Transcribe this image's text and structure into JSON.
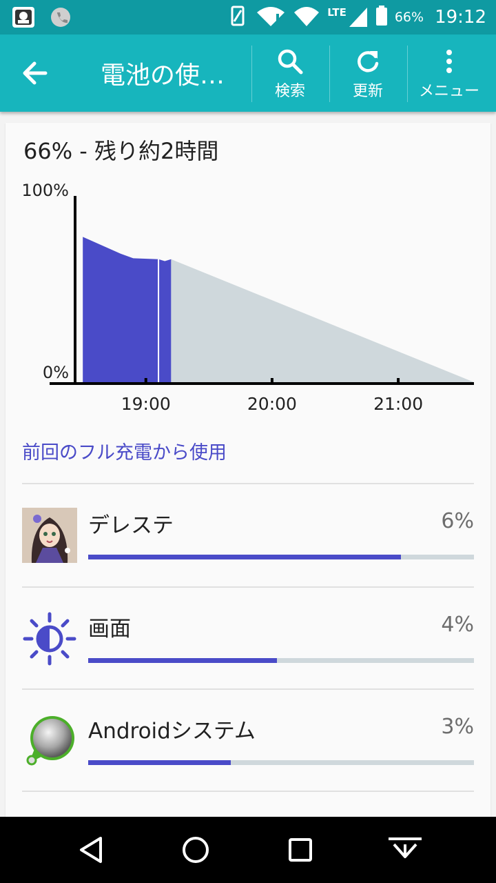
{
  "status_bar": {
    "battery": "66%",
    "time": "19:12",
    "network": "LTE"
  },
  "app_bar": {
    "back_icon": "arrow-left-icon",
    "title": "電池の使…",
    "actions": [
      {
        "icon": "search-icon",
        "label": "検索"
      },
      {
        "icon": "refresh-icon",
        "label": "更新"
      },
      {
        "icon": "more-vert-icon",
        "label": "メニュー"
      }
    ]
  },
  "summary": {
    "headline": "66% - 残り約2時間"
  },
  "chart_data": {
    "type": "area",
    "ylabels": [
      "100%",
      "0%"
    ],
    "ylim": [
      0,
      100
    ],
    "xticks": [
      "19:00",
      "20:00",
      "21:00"
    ],
    "series": [
      {
        "values": [
          [
            18.5,
            78
          ],
          [
            18.6,
            75
          ],
          [
            18.7,
            72
          ],
          [
            18.8,
            69
          ],
          [
            18.9,
            66.5
          ],
          [
            19.1,
            66
          ],
          [
            19.15,
            65
          ],
          [
            19.2,
            66
          ]
        ],
        "color": "#4a4bc8"
      },
      {
        "values": [
          [
            19.2,
            66
          ],
          [
            21.6,
            0
          ]
        ],
        "color": "#cfd8dc"
      }
    ],
    "marker_x": 19.1
  },
  "section_link": "前回のフル充電から使用",
  "usage_list": [
    {
      "name": "デレステ",
      "percent": "6%",
      "fraction": 0.81,
      "icon": "game-app-icon"
    },
    {
      "name": "画面",
      "percent": "4%",
      "fraction": 0.49,
      "icon": "brightness-icon"
    },
    {
      "name": "Androidシステム",
      "percent": "3%",
      "fraction": 0.37,
      "icon": "android-system-icon"
    }
  ],
  "nav": [
    "back-nav-icon",
    "home-nav-icon",
    "recents-nav-icon",
    "hide-nav-icon"
  ]
}
